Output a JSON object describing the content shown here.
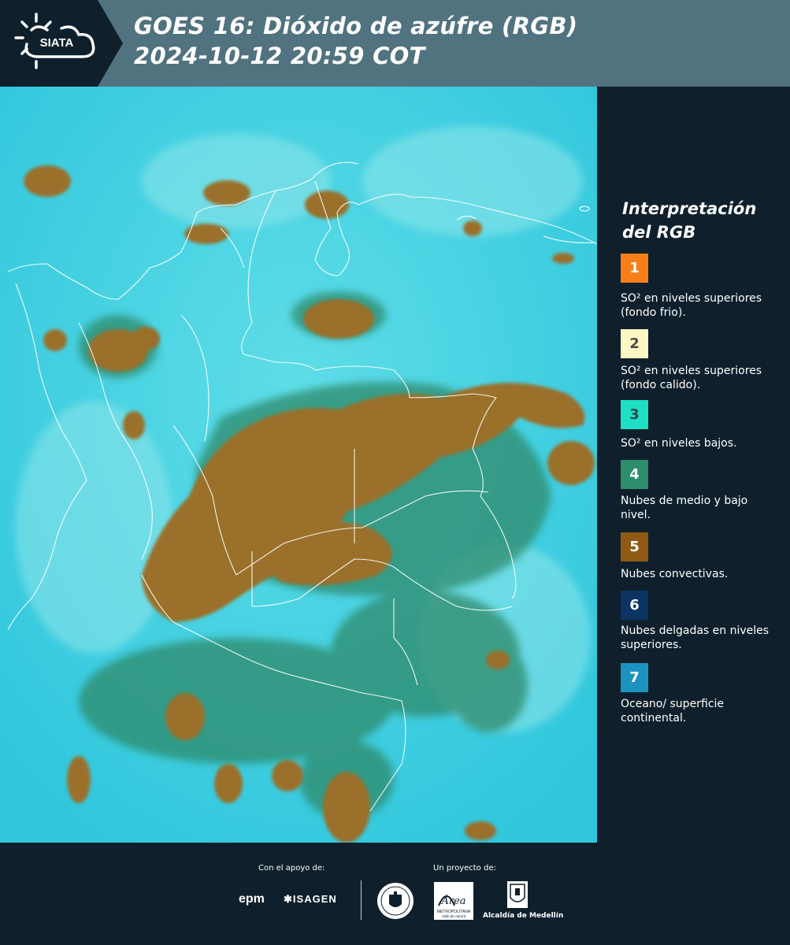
{
  "header": {
    "logo_text": "SIATA",
    "title_line1": "GOES 16: Dióxido de azúfre (RGB)",
    "title_line2": " 2024-10-12 20:59 COT"
  },
  "legend": {
    "title_line1": "Interpretación",
    "title_line2": "del RGB",
    "items": [
      {
        "number": "1",
        "color": "#f77f1a",
        "text_color": "#ffffff",
        "label": "SO² en niveles superiores (fondo frio)."
      },
      {
        "number": "2",
        "color": "#fdf7c4",
        "text_color": "#4a4a4a",
        "label": "SO² en niveles superiores (fondo calido)."
      },
      {
        "number": "3",
        "color": "#1fe0c4",
        "text_color": "#2a4a4a",
        "label": "SO² en niveles bajos."
      },
      {
        "number": "4",
        "color": "#2d8d6d",
        "text_color": "#ffffff",
        "label": "Nubes de medio y bajo nivel."
      },
      {
        "number": "5",
        "color": "#8f5a14",
        "text_color": "#ffffff",
        "label": "Nubes convectivas."
      },
      {
        "number": "6",
        "color": "#0b3463",
        "text_color": "#ffffff",
        "label": "Nubes delgadas en niveles superiores."
      },
      {
        "number": "7",
        "color": "#1b93bf",
        "text_color": "#ffffff",
        "label": "Oceano/ superficie continental."
      }
    ]
  },
  "footer": {
    "support_label": "Con el apoyo de:",
    "project_label": "Un proyecto de:",
    "sponsors": [
      "epm",
      "ISAGEN"
    ],
    "area_name": "Área",
    "area_sub1": "METROPOLITANA",
    "area_sub2": "Valle de Aburrá",
    "alcaldia": "Alcaldía de Medellín"
  },
  "colors": {
    "ocean": "#3fcfe0",
    "convective": "#9a6f2a",
    "midlevel": "#2f8a6a",
    "header_bg": "#51727f",
    "panel_bg": "#0f202c"
  }
}
